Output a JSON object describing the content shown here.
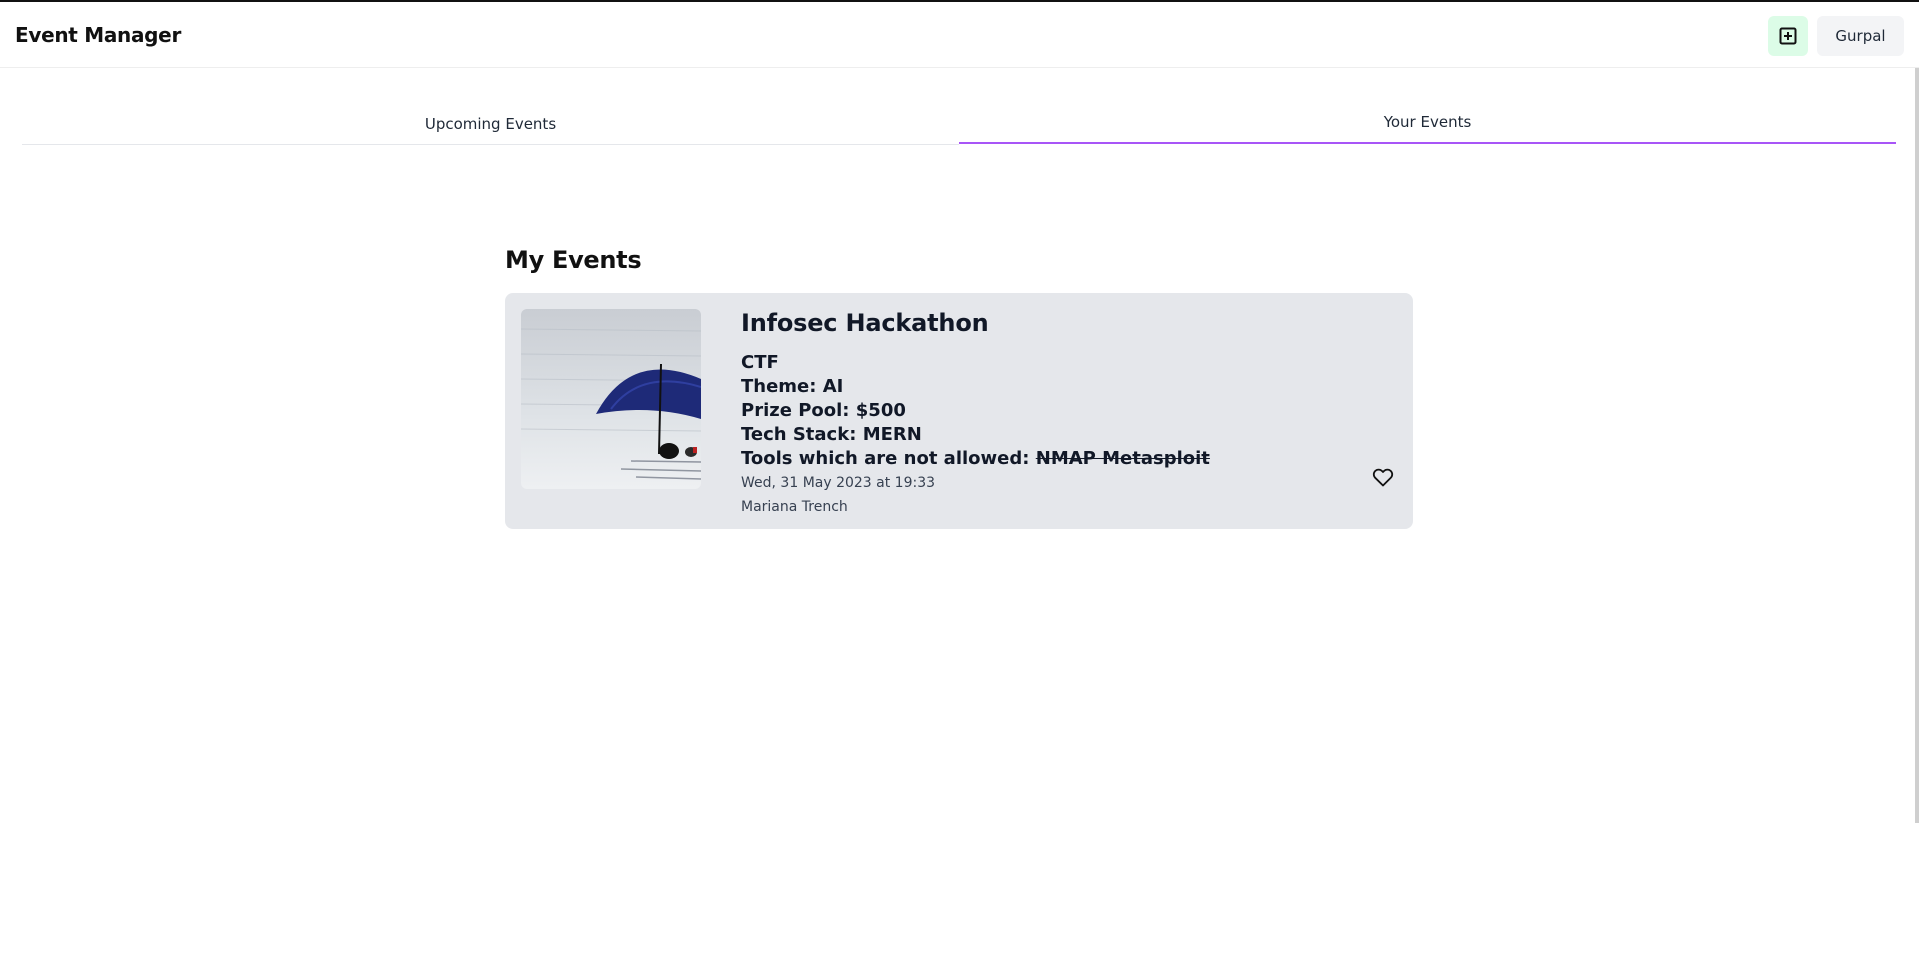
{
  "header": {
    "app_title": "Event Manager",
    "add_icon": "plus-square-icon",
    "user_label": "Gurpal"
  },
  "tabs": [
    {
      "label": "Upcoming Events",
      "active": false
    },
    {
      "label": "Your Events",
      "active": true
    }
  ],
  "colors": {
    "accent": "#a855f7",
    "add_button_bg": "#dcfce7",
    "card_bg": "#e5e7eb"
  },
  "main": {
    "section_title": "My Events",
    "events": [
      {
        "title": "Infosec Hackathon",
        "type": "CTF",
        "theme_label": "Theme:",
        "theme_value": "AI",
        "prize_label": "Prize Pool:",
        "prize_value": "$500",
        "stack_label": "Tech Stack:",
        "stack_value": "MERN",
        "tools_label": "Tools which are not allowed:",
        "tools_value": "NMAP Metasploit",
        "datetime": "Wed, 31 May 2023 at 19:33",
        "location": "Mariana Trench",
        "favorite_icon": "heart-icon"
      }
    ]
  }
}
